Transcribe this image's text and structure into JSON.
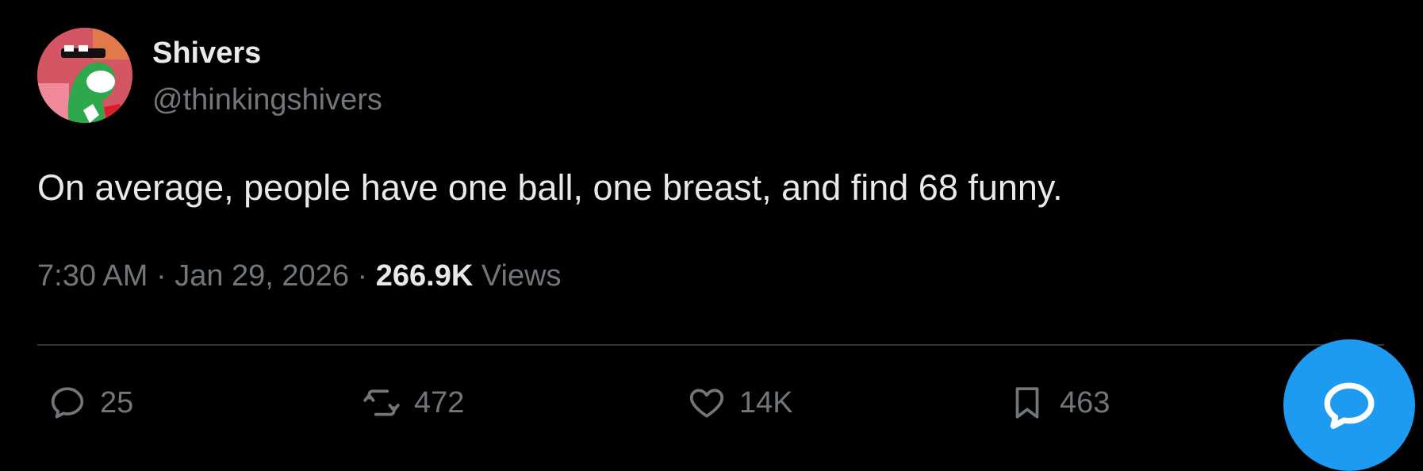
{
  "author": {
    "display_name": "Shivers",
    "handle": "@thinkingshivers",
    "avatar": "yoshi-avatar"
  },
  "tweet": {
    "text": "On average, people have one ball, one breast, and find 68 funny.",
    "time": "7:30 AM",
    "separator": "·",
    "date": "Jan 29, 2026",
    "views_count": "266.9K",
    "views_label": "Views"
  },
  "actions": {
    "reply": {
      "icon": "reply-icon",
      "count": "25"
    },
    "repost": {
      "icon": "repost-icon",
      "count": "472"
    },
    "like": {
      "icon": "heart-icon",
      "count": "14K"
    },
    "bookmark": {
      "icon": "bookmark-icon",
      "count": "463"
    }
  },
  "fab": {
    "icon": "chat-bubble-icon"
  },
  "colors": {
    "background": "#000000",
    "primary_text": "#e7e9ea",
    "secondary_text": "#71767b",
    "divider": "#2f3336",
    "accent": "#1d9bf0"
  }
}
